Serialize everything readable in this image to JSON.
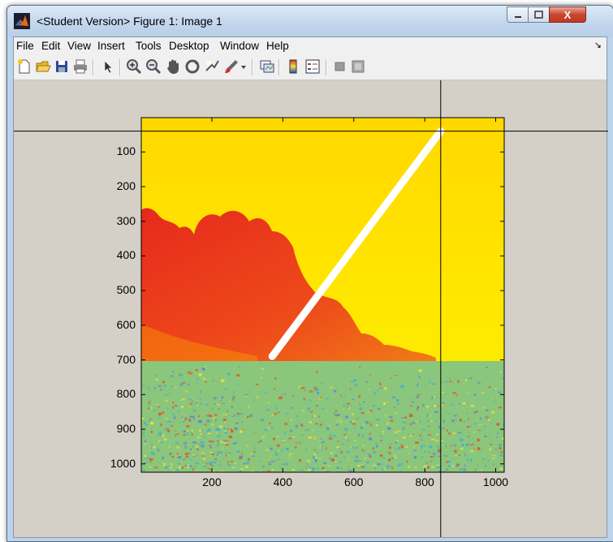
{
  "window": {
    "title": "<Student Version> Figure 1: Image 1",
    "close_label": "X"
  },
  "menubar": {
    "items": [
      "File",
      "Edit",
      "View",
      "Insert",
      "Tools",
      "Desktop",
      "Window",
      "Help"
    ],
    "overflow_label": "↘"
  },
  "toolbar": {
    "buttons": [
      "new-figure-icon",
      "open-file-icon",
      "save-icon",
      "print-icon",
      "edit-plot-arrow-icon",
      "zoom-in-icon",
      "zoom-out-icon",
      "pan-hand-icon",
      "rotate-3d-icon",
      "data-cursor-icon",
      "brush-icon",
      "brush-dropdown-icon",
      "link-plot-icon",
      "insert-colorbar-icon",
      "insert-legend-icon",
      "hide-plot-tools-icon",
      "show-plot-tools-icon"
    ]
  },
  "axes": {
    "y_ticks": [
      "100",
      "200",
      "300",
      "400",
      "500",
      "600",
      "700",
      "800",
      "900",
      "1000"
    ],
    "x_ticks": [
      "200",
      "400",
      "600",
      "800",
      "1000"
    ],
    "xlim": [
      1,
      1024
    ],
    "ylim": [
      1,
      1024
    ],
    "crosshair": {
      "x": 845,
      "y": 40
    },
    "line": {
      "x1": 845,
      "y1": 40,
      "x2": 370,
      "y2": 690,
      "color": "#ffffff"
    }
  },
  "image_colors": {
    "sky": "#ffd900",
    "smoke": "#e8281c",
    "ground": "#88c878",
    "noise": [
      "#3ab0d8",
      "#e8e040",
      "#e85020",
      "#5a8ad0"
    ]
  }
}
